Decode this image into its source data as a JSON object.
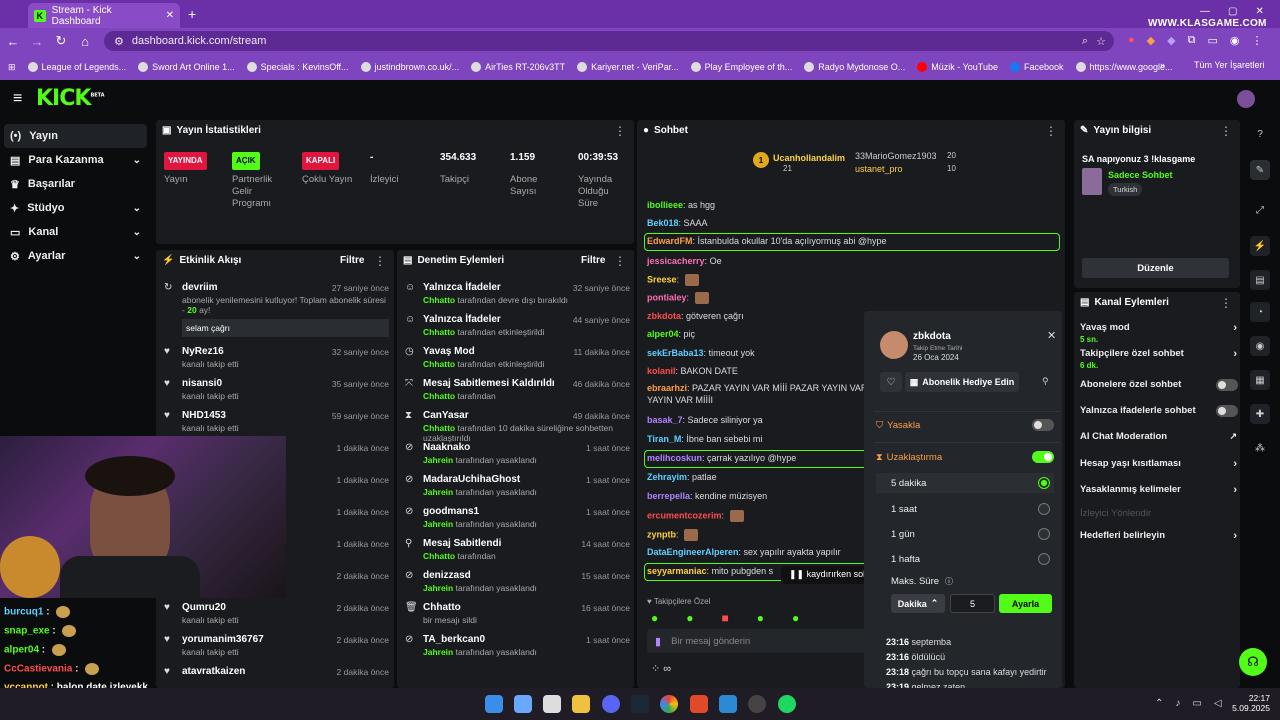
{
  "browser": {
    "tab_title": "Stream - Kick Dashboard",
    "url": "dashboard.kick.com/stream",
    "watermark": "WWW.KLASGAME.COM",
    "bookmarks": [
      "League of Legends...",
      "Sword Art Online 1...",
      "Specials : KevinsOff...",
      "justindbrown.co.uk/...",
      "AirTies RT-206v3TT",
      "Kariyer.net - VeriPar...",
      "Play Employee of th...",
      "Radyo Mydonose O...",
      "Müzik - YouTube",
      "Facebook",
      "https://www.google..."
    ],
    "all_bookmarks": "Tüm Yer İşaretleri"
  },
  "app": {
    "logo": "KICK",
    "logo_tag": "BETA"
  },
  "sidebar": {
    "items": [
      {
        "label": "Yayın",
        "icon": "broadcast-icon"
      },
      {
        "label": "Para Kazanma",
        "icon": "dollar-icon"
      },
      {
        "label": "Başarılar",
        "icon": "trophy-icon"
      },
      {
        "label": "Stüdyo",
        "icon": "studio-icon"
      },
      {
        "label": "Kanal",
        "icon": "channel-icon"
      },
      {
        "label": "Ayarlar",
        "icon": "gear-icon"
      }
    ]
  },
  "stats": {
    "title": "Yayın İstatistikleri",
    "cols": [
      {
        "badge": "YAYINDA",
        "label": "Yayın",
        "color": "#e0163f"
      },
      {
        "badge": "AÇIK",
        "label": "Partnerlik Gelir Programı",
        "color": "#53fc18"
      },
      {
        "badge": "KAPALI",
        "label": "Çoklu Yayın",
        "color": "#e0163f"
      },
      {
        "value": "-",
        "label": "İzleyici"
      },
      {
        "value": "354.633",
        "label": "Takipçi"
      },
      {
        "value": "1.159",
        "label": "Abone Sayısı"
      },
      {
        "value": "00:39:53",
        "label": "Yayında Olduğu Süre"
      }
    ]
  },
  "activity": {
    "title": "Etkinlik Akışı",
    "filter": "Filtre",
    "events": [
      {
        "name": "devriim",
        "sub1": "abonelik yenilemesini kutluyor! Toplam abonelik süresi -",
        "sub2": "20",
        "sub3": "ay!",
        "time": "27 saniye önce",
        "quote": "selam çağrı"
      },
      {
        "name": "NyRez16",
        "sub": "kanalı takip etti",
        "time": "32 saniye önce"
      },
      {
        "name": "nisansi0",
        "sub": "kanalı takip etti",
        "time": "35 saniye önce"
      },
      {
        "name": "NHD1453",
        "sub": "kanalı takip etti",
        "time": "59 saniye önce"
      },
      {
        "time": "1 dakika önce"
      },
      {
        "time": "1 dakika önce"
      },
      {
        "time": "1 dakika önce"
      },
      {
        "time": "1 dakika önce"
      },
      {
        "time": "2 dakika önce"
      },
      {
        "name": "Qumru20",
        "sub": "kanalı takip etti",
        "time": "2 dakika önce"
      },
      {
        "name": "yorumanim36767",
        "sub": "kanalı takip etti",
        "time": "2 dakika önce"
      },
      {
        "name": "atavratkaizen",
        "time": "2 dakika önce"
      }
    ]
  },
  "mod": {
    "title": "Denetim Eylemleri",
    "filter": "Filtre",
    "events": [
      {
        "name": "Yalnızca İfadeler",
        "who": "Chhatto",
        "sub": "tarafından devre dışı bırakıldı",
        "time": "32 saniye önce"
      },
      {
        "name": "Yalnızca İfadeler",
        "who": "Chhatto",
        "sub": "tarafından etkinleştirildi",
        "time": "44 saniye önce"
      },
      {
        "name": "Yavaş Mod",
        "who": "Chhatto",
        "sub": "tarafından etkinleştirildi",
        "time": "11 dakika önce"
      },
      {
        "name": "Mesaj Sabitlemesi Kaldırıldı",
        "who": "Chhatto",
        "sub": "tarafından",
        "time": "46 dakika önce"
      },
      {
        "name": "CanYasar",
        "who": "Chhatto",
        "sub": "tarafından 10 dakika süreliğine sohbetten uzaklaştırıldı",
        "time": "49 dakika önce"
      },
      {
        "name": "Naaknako",
        "who": "Jahrein",
        "sub": "tarafından yasaklandı",
        "time": "1 saat önce"
      },
      {
        "name": "MadaraUchihaGhost",
        "who": "Jahrein",
        "sub": "tarafından yasaklandı",
        "time": "1 saat önce"
      },
      {
        "name": "goodmans1",
        "who": "Jahrein",
        "sub": "tarafından yasaklandı",
        "time": "1 saat önce"
      },
      {
        "name": "Mesaj Sabitlendi",
        "who": "Chhatto",
        "sub": "tarafından",
        "time": "14 saat önce"
      },
      {
        "name": "denizzasd",
        "who": "Jahrein",
        "sub": "tarafından yasaklandı",
        "time": "15 saat önce"
      },
      {
        "name": "Chhatto",
        "who": "",
        "sub": "bir mesajı sildi",
        "time": "16 saat önce"
      },
      {
        "name": "TA_berkcan0",
        "who": "Jahrein",
        "sub": "tarafından yasaklandı",
        "time": "1 saat önce"
      }
    ]
  },
  "chat": {
    "title": "Sohbet",
    "top_gifters": [
      {
        "name": "Ucanhollandalim",
        "count": "21"
      },
      {
        "name": "33MarioGomez1903",
        "count": "20"
      },
      {
        "name": "ustanet_pro",
        "count": "10"
      }
    ],
    "messages": [
      {
        "user": "ibollieee",
        "text": "as hgg",
        "color": "#53fc18"
      },
      {
        "user": "Bek018",
        "text": "SAAA",
        "color": "#5fd0ff"
      },
      {
        "user": "EdwardFM",
        "text": "İstanbulda okullar 10'da açılıyormuş abi @hype",
        "color": "#ff9f43"
      },
      {
        "user": "jessicacherry",
        "text": "Oe",
        "color": "#ff6fb5"
      },
      {
        "user": "Sreese",
        "text": "",
        "color": "#ffd23f"
      },
      {
        "user": "pontialey",
        "text": "",
        "color": "#ff6fb5"
      },
      {
        "user": "zbkdota",
        "text": "götveren çağrı",
        "color": "#ff4d4d"
      },
      {
        "user": "alper04",
        "text": "piç",
        "color": "#53fc18"
      },
      {
        "user": "sekErBaba13",
        "text": "timeout yok",
        "color": "#5fd0ff"
      },
      {
        "user": "kolanil",
        "text": "BAKON DATE",
        "color": "#ff4d4d"
      },
      {
        "user": "ebraarhzi",
        "text": "PAZAR YAYIN VAR Mİİİ PAZAR YAYIN VAR MİİİI",
        "text2": "YAYIN VAR MİİİI",
        "color": "#ff9f43"
      },
      {
        "user": "basak_7",
        "text": "Sadece siliniyor ya",
        "color": "#b084ff"
      },
      {
        "user": "Tiran_M",
        "text": "İbne ban sebebi mi",
        "color": "#5fd0ff"
      },
      {
        "user": "melihcoskun",
        "text": "çarrak yazılıyo @hype",
        "color": "#b084ff"
      },
      {
        "user": "Zehrayim",
        "text": "patlae",
        "color": "#5fd0ff"
      },
      {
        "user": "berrepella",
        "text": "kendine müzisyen",
        "color": "#b084ff"
      },
      {
        "user": "ercumentcozerim",
        "text": "",
        "color": "#ff4d4d"
      },
      {
        "user": "zynptb",
        "text": "",
        "color": "#ffd23f"
      },
      {
        "user": "DataEngineerAlperen",
        "text": "sex yapılır ayakta yapılır",
        "color": "#5fd0ff"
      },
      {
        "user": "seyyarmaniac",
        "text": "mito pubgden s",
        "color": "#ffd23f"
      }
    ],
    "paused": "kaydırırken sohl",
    "followers_only": "Takipçilere Özel",
    "input_placeholder": "Bir mesaj gönderin"
  },
  "user_popup": {
    "username": "zbkdota",
    "follow_date_label": "Takip Etme Tarihi",
    "follow_date": "26 Oca 2024",
    "gift_button": "Abonelik Hediye Edin",
    "ban_label": "Yasakla",
    "timeout_label": "Uzaklaştırma",
    "options": [
      "5 dakika",
      "1 saat",
      "1 gün",
      "1 hafta"
    ],
    "selected": 0,
    "max_label": "Maks. Süre",
    "unit": "Dakika",
    "value": "5",
    "apply": "Ayarla",
    "history": [
      {
        "time": "23:16",
        "text": "septemba"
      },
      {
        "time": "23:16",
        "text": "öldülücü"
      },
      {
        "time": "23:18",
        "text": "çağrı bu topçu sana kafayı yedirtir"
      },
      {
        "time": "23:19",
        "text": "gelmez zaten"
      }
    ]
  },
  "stream_info": {
    "title": "Yayın bilgisi",
    "stream_title": "SA napıyonuz 3 !klasgame",
    "category": "Sadece Sohbet",
    "tag": "Turkish",
    "edit": "Düzenle"
  },
  "channel_actions": {
    "title": "Kanal Eylemleri",
    "items": [
      {
        "label": "Yavaş mod",
        "sub": "5 sn.",
        "kind": "chevron"
      },
      {
        "label": "Takipçilere özel sohbet",
        "sub": "6 dk.",
        "kind": "chevron"
      },
      {
        "label": "Abonelere özel sohbet",
        "kind": "toggle"
      },
      {
        "label": "Yalnızca ifadelerle sohbet",
        "kind": "toggle"
      },
      {
        "label": "AI Chat Moderation",
        "kind": "external"
      },
      {
        "label": "Hesap yaşı kısıtlaması",
        "kind": "chevron"
      },
      {
        "label": "Yasaklanmış kelimeler",
        "kind": "chevron"
      },
      {
        "label": "İzleyici Yönlendir",
        "kind": "disabled"
      },
      {
        "label": "Hedefleri belirleyin",
        "kind": "chevron"
      }
    ]
  },
  "webcam_chat": [
    {
      "user": "burcuq1",
      "text": "",
      "color": "#5fd0ff"
    },
    {
      "user": "snap_exe",
      "text": "",
      "color": "#53fc18"
    },
    {
      "user": "alper04",
      "text": "",
      "color": "#53fc18"
    },
    {
      "user": "CcCastievania",
      "text": "",
      "color": "#ff4d4d"
    },
    {
      "user": "yccannot",
      "text": "balon date izleyekk",
      "color": "#ffd23f"
    }
  ],
  "taskbar": {
    "time": "22:17",
    "date": "5.09.2025"
  }
}
